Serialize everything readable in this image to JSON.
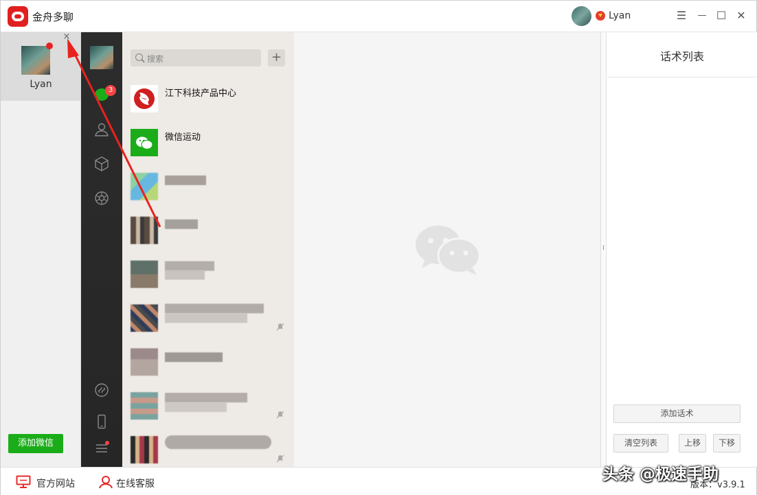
{
  "app": {
    "title": "金舟多聊",
    "user": "Lyan"
  },
  "window_controls": {
    "menu": "☰",
    "minimize": "—",
    "maximize": "☐",
    "close": "✕"
  },
  "accounts": [
    {
      "name": "Lyan",
      "close": "×"
    }
  ],
  "add_wechat_label": "添加微信",
  "wechat": {
    "unread_badge": "3",
    "search_placeholder": "搜索",
    "add_button": "+",
    "contacts": [
      {
        "name": "江下科技产品中心"
      },
      {
        "name": "微信运动"
      },
      {
        "name": ""
      },
      {
        "name": ""
      },
      {
        "name": ""
      },
      {
        "name": ""
      },
      {
        "name": ""
      },
      {
        "name": ""
      },
      {
        "name": ""
      }
    ]
  },
  "right_panel": {
    "title": "话术列表",
    "add_label": "添加话术",
    "clear_label": "清空列表",
    "up_label": "上移",
    "down_label": "下移"
  },
  "bottom": {
    "website_label": "官方网站",
    "service_label": "在线客服",
    "version": "版本：v3.9.1"
  },
  "watermark": "头条 @极速手助",
  "colors": {
    "accent_green": "#1aad19",
    "brand_red": "#e02020",
    "badge_red": "#f54545",
    "sidebar_dark": "#2a2a2a"
  }
}
